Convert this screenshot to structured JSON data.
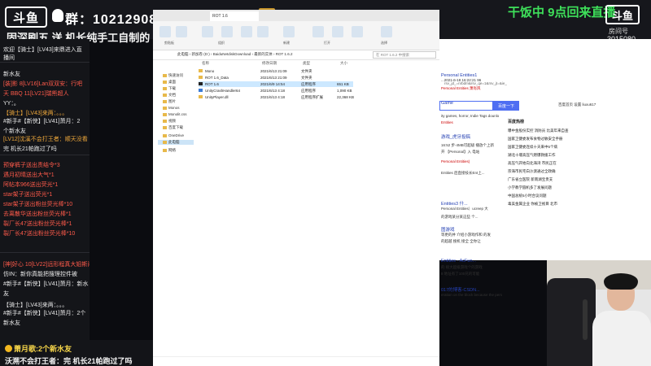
{
  "overlay": {
    "logo": "斗鱼",
    "qq_group": "群：1021290811",
    "title": "固深刷五 送 机长纯手工自制的",
    "live_status": "干饭中 9点回来直播",
    "brand": "斗鱼",
    "room_label": "房间号",
    "room_number": "3015080"
  },
  "chat": {
    "lines": [
      {
        "text": "欢迎【骑士】[LV43]来鼎进入直",
        "style": "normal"
      },
      {
        "text": "播间",
        "style": "normal"
      },
      {
        "text": "新水友",
        "style": "normal"
      },
      {
        "text": "[装]影 8[LV16]Lan双双安：行吧",
        "style": "red"
      },
      {
        "text": "天 BBQ 11[LV21]瑞熊超人",
        "style": "red"
      },
      {
        "text": "YY：。",
        "style": "normal"
      },
      {
        "text": "【骑士】[LV43]来两：。。。",
        "style": "orange"
      },
      {
        "text": "#新手#【新侠】[LV41]萧月：2",
        "style": "normal"
      },
      {
        "text": "个新水友",
        "style": "normal"
      },
      {
        "text": "[LV12]沈溪不会打王者：顺天没看",
        "style": "orange"
      },
      {
        "text": "完 机长21帕跑过了吗",
        "style": "normal"
      },
      {
        "text": "预穿裤子送出责结令*3",
        "style": "red"
      },
      {
        "text": "遇月初晴送出大气*1",
        "style": "red"
      },
      {
        "text": "阿帖本966送出荧光*1",
        "style": "red"
      },
      {
        "text": "star架子送出荧光*1",
        "style": "red"
      },
      {
        "text": "star架子送出粉丝荧光棒*10",
        "style": "red"
      },
      {
        "text": "去离散华送出粉丝荧光棒*1",
        "style": "red"
      },
      {
        "text": "裂厂长47送出粉丝荧光棒*1",
        "style": "red"
      },
      {
        "text": "裂厂长47送出粉丝荧光棒*10",
        "style": "red"
      },
      {
        "text": "[神]好心 10[LV22]远形程真大姐斯问",
        "style": "red"
      },
      {
        "text": "仿IN：新你真能把搜理控件被",
        "style": "normal"
      },
      {
        "text": "#新手#【新侠】[LV41]萧月：新水",
        "style": "normal"
      },
      {
        "text": "友",
        "style": "normal"
      },
      {
        "text": "【骑士】[LV43]来两：。。。",
        "style": "normal"
      },
      {
        "text": "#新手#【新侠】[LV41]萧月：2个",
        "style": "normal"
      },
      {
        "text": "新水友",
        "style": "normal"
      }
    ]
  },
  "explorer": {
    "tab_title": "ROT 1.6",
    "ribbon_buttons": [
      "复制路径",
      "粘贴快捷方式",
      "移动到",
      "复制到",
      "删除",
      "重命名",
      "新建文件夹",
      "属性",
      "打开",
      "编辑",
      "全部选择"
    ],
    "ribbon_groups": [
      "剪贴板",
      "组织",
      "新建",
      "打开",
      "选择"
    ],
    "address_path": "此电脑 › 新加卷 (D:) › BaiduNetdiskDownload › 最新的实体 › ROT 1.6.2",
    "search_placeholder": "在 ROT 1.6.2 中搜索",
    "nav_items": [
      {
        "label": "快速访问",
        "selected": false
      },
      {
        "label": "桌面",
        "selected": false
      },
      {
        "label": "下载",
        "selected": false
      },
      {
        "label": "文档",
        "selected": false
      },
      {
        "label": "图片",
        "selected": false
      },
      {
        "label": "Monos",
        "selected": false
      },
      {
        "label": "Monolit.css",
        "selected": false
      },
      {
        "label": "视频",
        "selected": false
      },
      {
        "label": "百度下载",
        "selected": false
      },
      {
        "label": "OneDrive",
        "selected": false
      },
      {
        "label": "此电脑",
        "selected": true
      },
      {
        "label": "网络",
        "selected": false
      }
    ],
    "columns": [
      "名称",
      "修改日期",
      "类型",
      "大小"
    ],
    "files": [
      {
        "name": "Mono",
        "date": "2021/6/13 21:09",
        "type": "文件夹",
        "size": "",
        "icon": "folder",
        "selected": false
      },
      {
        "name": "ROT 1.6_Data",
        "date": "2021/6/13 21:09",
        "type": "文件夹",
        "size": "",
        "icon": "folder",
        "selected": false
      },
      {
        "name": "ROT 1.6",
        "date": "2021/6/9 14:54",
        "type": "应用程序",
        "size": "651 KB",
        "icon": "app-dark",
        "selected": true
      },
      {
        "name": "UnityCrashHandler64",
        "date": "2021/6/13 4:18",
        "type": "应用程序",
        "size": "1,090 KB",
        "icon": "app",
        "selected": false
      },
      {
        "name": "UnityPlayer.dll",
        "date": "2021/6/13 4:18",
        "type": "应用程序扩展",
        "size": "22,368 KB",
        "icon": "file",
        "selected": false
      }
    ]
  },
  "browser": {
    "tab_text": "rsv_jd_=nrbdm&rsv_qe=1&rsv_jt=&ie_",
    "search_button": "百度一下",
    "user_area": "百度首页    设置    liuxu617",
    "hot_title": "百度热榜",
    "hot_items": [
      "曝中金股份实控 消防员 比美年来自查",
      "国家卫健委发布食物过敏安全手册",
      "国家卫健委连续十天来中5个病",
      "湖北十堰高压气燃爆救援工作",
      "高压气开始向北海湾 市民正在",
      "宗海市民宅白沙渡通过全政确",
      "广东省立医院 新南湖宝贵支",
      "小学教学圆机多了发展问题",
      "中国总统5小时合议问题",
      "毒美金属企业 你被卫视目 北市"
    ],
    "results": [
      {
        "text": "Personal Entities1 ",
        "style": "link"
      },
      {
        "text": "...2021-6-18 16:22:21 96",
        "style": "normal"
      },
      {
        "text": "Personal Entities 萧肖风",
        "style": "red"
      },
      {
        "text": "Game",
        "style": "link"
      },
      {
        "text": "ity games, horror, Indie Tags dounlo",
        "style": "normal"
      },
      {
        "text": "Entities",
        "style": "red"
      },
      {
        "text": "游戏_虎牙投稿",
        "style": "link"
      },
      {
        "text": "16:52 步-4MB可超级 播放个上新",
        "style": "normal"
      },
      {
        "text": "开 【Personal】入 电站",
        "style": "normal"
      },
      {
        "text": "Personal Entities)",
        "style": "red"
      },
      {
        "text": "Entities 后直接技长Ent上...",
        "style": "normal"
      },
      {
        "text": "Entities3 什...",
        "style": "link"
      },
      {
        "text": "Personal Entities）ucreep 大",
        "style": "normal"
      },
      {
        "text": "的游戏某分某这些 个...",
        "style": "normal"
      },
      {
        "text": "图游戏",
        "style": "link"
      },
      {
        "text": "等更的并 介绍小游戏作和 的发",
        "style": "normal"
      },
      {
        "text": "的超越 搜机 接全 全你让",
        "style": "normal"
      },
      {
        "text": "Entities - AcFun...",
        "style": "link"
      },
      {
        "text": "的 很大超级游戏个的游戏",
        "style": "normal"
      },
      {
        "text": "8 地址有了100兄的可能",
        "style": "normal"
      },
      {
        "text": "017的博客-CSDN...",
        "style": "link"
      },
      {
        "text": "eration on the block because the pers",
        "style": "normal"
      }
    ]
  },
  "bottom": {
    "donate": "萧月歌:2个新水友",
    "ticker": "沃溯不会打王者：完 机长21帕跑过了吗"
  },
  "colors": {
    "live_green": "#3ee05a",
    "chat_red": "#ff5a4a",
    "chat_orange": "#f0a93b",
    "baidu_blue": "#4e6ef2",
    "donate_yellow": "#f7d64a"
  }
}
